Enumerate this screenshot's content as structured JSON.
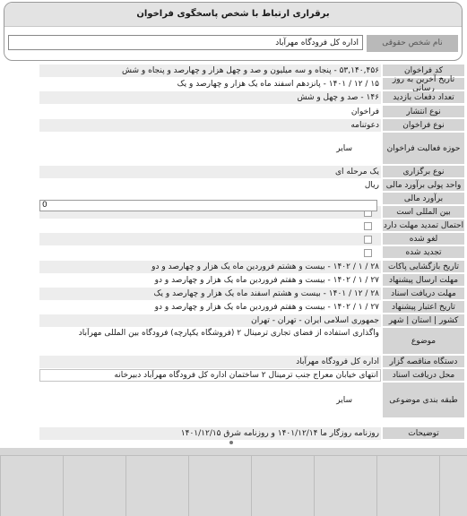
{
  "contact": {
    "title": "برقراری ارتباط با شخص پاسخگوی فراخوان",
    "legal_name_label": "نام شخص حقوقی",
    "legal_name_value": "اداره کل فرودگاه مهرآباد"
  },
  "fields": [
    {
      "label": "کد فراخوان",
      "value": "۵۳,۱۴۰,۴۵۶ - پنجاه و سه میلیون و صد و چهل هزار و چهارصد و پنجاه و شش"
    },
    {
      "label": "تاریخ آخرین به روز رسانی",
      "value": "۱۵ / ۱۲ / ۱۴۰۱ - پانزدهم اسفند ماه یک هزار و چهارصد و یک"
    },
    {
      "label": "تعداد دفعات بازدید",
      "value": "۱۴۶ - صد و چهل و شش"
    },
    {
      "label": "نوع انتشار",
      "value": "فراخوان"
    },
    {
      "label": "نوع فراخوان",
      "value": "دعوتنامه"
    },
    {
      "label": "حوزه فعالیت فراخوان",
      "value": "سایر"
    },
    {
      "label": "نوع برگزاری",
      "value": "یک مرحله ای"
    },
    {
      "label": "واحد پولی برآورد مالی",
      "value": "ریال"
    },
    {
      "label": "برآورد مالی",
      "value": "0"
    },
    {
      "label": "بین المللی است",
      "value": ""
    },
    {
      "label": "احتمال تمدید مهلت دارد",
      "value": ""
    },
    {
      "label": "لغو شده",
      "value": ""
    },
    {
      "label": "تجدید شده",
      "value": ""
    },
    {
      "label": "تاریخ بازگشایی پاکات",
      "value": "۲۸ / ۱ / ۱۴۰۲ - بیست و هشتم فروردین ماه یک هزار و چهارصد و دو"
    },
    {
      "label": "مهلت ارسال پیشنهاد",
      "value": "۲۷ / ۱ / ۱۴۰۲ - بیست و هفتم فروردین ماه یک هزار و چهارصد و دو"
    },
    {
      "label": "مهلت دریافت اسناد",
      "value": "۲۸ / ۱۲ / ۱۴۰۱ - بیست و هشتم اسفند ماه یک هزار و چهارصد و یک"
    },
    {
      "label": "تاریخ اعتبار پیشنهاد",
      "value": "۲۷ / ۱ / ۱۴۰۲ - بیست و هفتم فروردین ماه یک هزار و چهارصد و دو"
    },
    {
      "label": "کشور | استان | شهر",
      "value": "جمهوری اسلامی ایران - تهران - تهران"
    },
    {
      "label": "موضوع",
      "value": "واگذاری استفاده از فضای تجاری ترمینال ۲ (فروشگاه یکپارچه) فرودگاه بین المللی مهرآباد"
    },
    {
      "label": "دستگاه مناقصه گزار",
      "value": "اداره کل فرودگاه مهرآباد"
    },
    {
      "label": "محل دریافت اسناد",
      "value": "انتهای خیابان معراج جنب ترمینال ۲ ساختمان اداره کل فرودگاه مهرآباد دبیرخانه"
    },
    {
      "label": "طبقه بندی موضوعی",
      "value": "سایر"
    },
    {
      "label": "توضیحات",
      "value": "روزنامه روزگار ما ۱۴۰۱/۱۲/۱۴ و روزنامه شرق ۱۴۰۱/۱۲/۱۵"
    }
  ],
  "colors": {
    "label_bg": "#d4d4d4",
    "header_bg": "#e3e3e3",
    "value_shade": "#ededed"
  }
}
